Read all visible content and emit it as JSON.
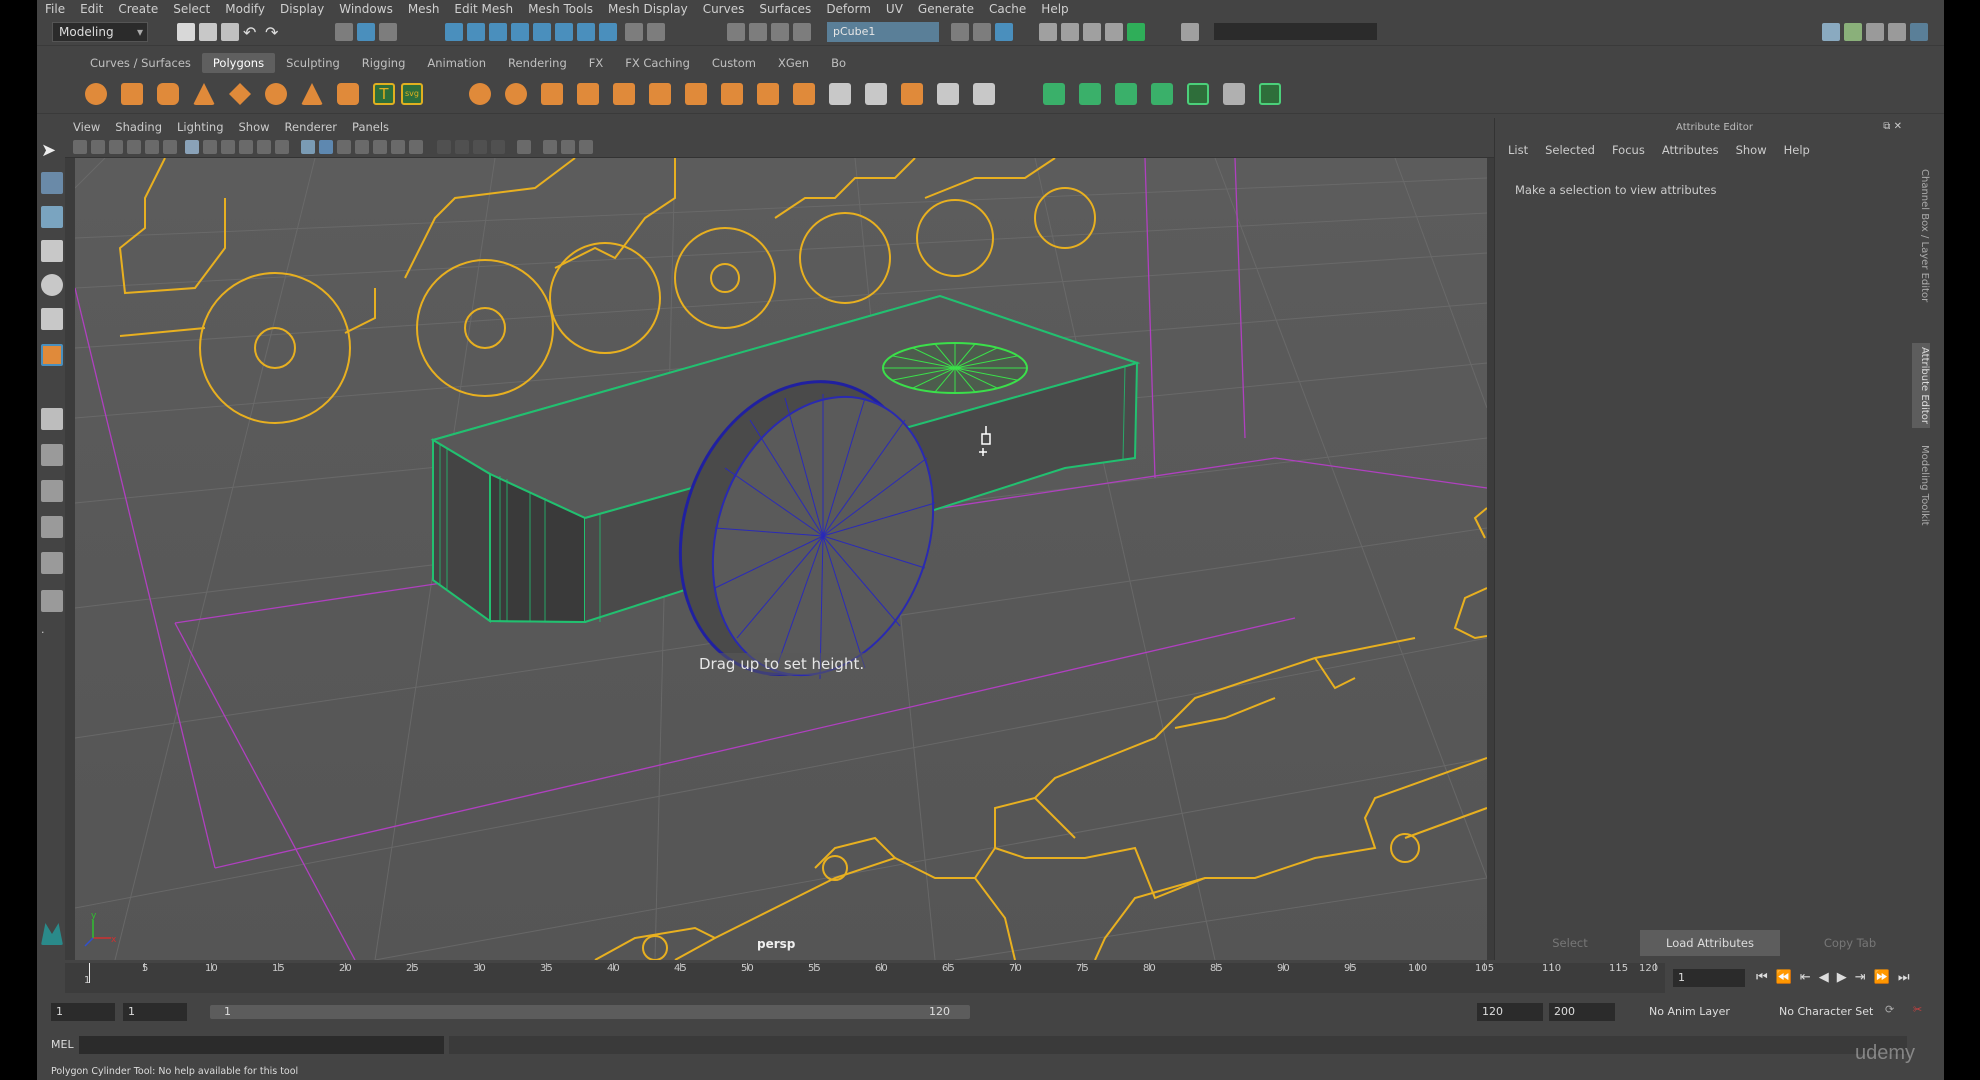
{
  "menubar": {
    "items": [
      "File",
      "Edit",
      "Create",
      "Select",
      "Modify",
      "Display",
      "Windows",
      "Mesh",
      "Edit Mesh",
      "Mesh Tools",
      "Mesh Display",
      "Curves",
      "Surfaces",
      "Deform",
      "UV",
      "Generate",
      "Cache",
      "Help"
    ]
  },
  "statusline": {
    "mode": "Modeling",
    "object_name": "pCube1"
  },
  "shelf": {
    "tabs": [
      "Curves / Surfaces",
      "Polygons",
      "Sculpting",
      "Rigging",
      "Animation",
      "Rendering",
      "FX",
      "FX Caching",
      "Custom",
      "XGen",
      "Bo"
    ],
    "active_tab": "Polygons"
  },
  "viewport": {
    "menu": [
      "View",
      "Shading",
      "Lighting",
      "Show",
      "Renderer",
      "Panels"
    ],
    "hud_message": "Drag up to set height.",
    "camera_label": "persp",
    "axis_x": "x",
    "axis_y": "y"
  },
  "attribute_editor": {
    "title": "Attribute Editor",
    "menu": [
      "List",
      "Selected",
      "Focus",
      "Attributes",
      "Show",
      "Help"
    ],
    "message": "Make a selection to view attributes",
    "buttons": [
      "Select",
      "Load Attributes",
      "Copy Tab"
    ],
    "side_tabs": [
      "Channel Box / Layer Editor",
      "Attribute Editor",
      "Modeling Toolkit"
    ]
  },
  "timeslider": {
    "ticks": [
      "1",
      "5",
      "10",
      "15",
      "20",
      "25",
      "30",
      "35",
      "40",
      "45",
      "50",
      "55",
      "60",
      "65",
      "70",
      "75",
      "80",
      "85",
      "90",
      "95",
      "100",
      "105",
      "110",
      "115",
      "120"
    ],
    "current_frame": "1"
  },
  "range": {
    "start": "1",
    "current": "1",
    "slider_start": "1",
    "slider_end": "120",
    "end": "120",
    "anim_end": "200",
    "anim_layer": "No Anim Layer",
    "character_set": "No Character Set"
  },
  "command_line": {
    "label": "MEL",
    "help_text": "Polygon Cylinder Tool: No help available for this tool"
  },
  "watermark": "udemy"
}
